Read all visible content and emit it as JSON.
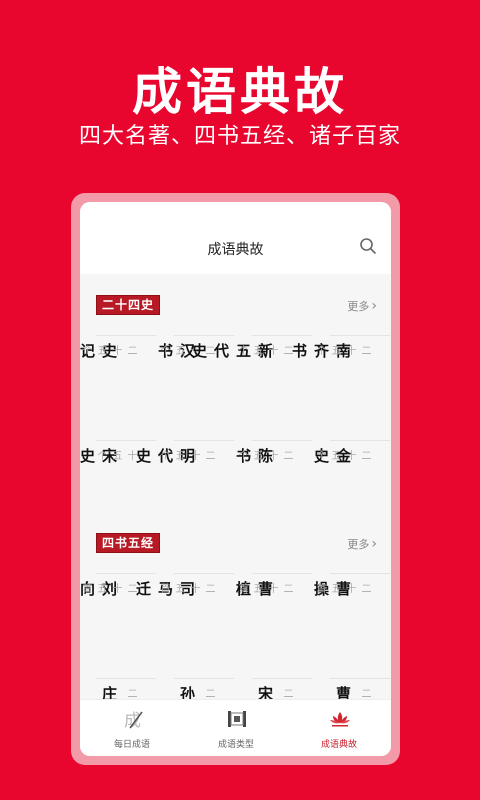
{
  "hero": {
    "title": "成语典故",
    "subtitle": "四大名著、四书五经、诸子百家"
  },
  "app": {
    "title": "成语典故",
    "search_icon": "search-icon"
  },
  "sections": [
    {
      "tag": "二十四史",
      "more": "更多",
      "items": [
        {
          "name": "史记",
          "count": "二十五个"
        },
        {
          "name": "汉书",
          "count": "二十五个"
        },
        {
          "name": "新五代史",
          "count": "二十五个"
        },
        {
          "name": "南齐书",
          "count": "二十五个"
        },
        {
          "name": "宋史",
          "count": "十五个"
        },
        {
          "name": "明代史",
          "count": "二十五个"
        },
        {
          "name": "陈书",
          "count": "二十五个"
        },
        {
          "name": "金史",
          "count": "二十五个"
        }
      ]
    },
    {
      "tag": "四书五经",
      "more": "更多",
      "items": [
        {
          "name": "刘向",
          "count": "二十五首"
        },
        {
          "name": "司马迁",
          "count": "二十五首"
        },
        {
          "name": "曹植",
          "count": "二十五首"
        },
        {
          "name": "曹操",
          "count": "二十五首"
        },
        {
          "name": "庄",
          "count": "二"
        },
        {
          "name": "孙",
          "count": "二"
        },
        {
          "name": "宋",
          "count": "二"
        },
        {
          "name": "曹",
          "count": "二"
        }
      ]
    }
  ],
  "bottom_nav": [
    {
      "label": "每日成语",
      "icon": "brush-icon",
      "active": false
    },
    {
      "label": "成语类型",
      "icon": "scroll-icon",
      "active": false
    },
    {
      "label": "成语典故",
      "icon": "lotus-icon",
      "active": true
    }
  ],
  "colors": {
    "background": "#e8062f",
    "accent": "#c7202e",
    "tag": "#b71a25"
  }
}
